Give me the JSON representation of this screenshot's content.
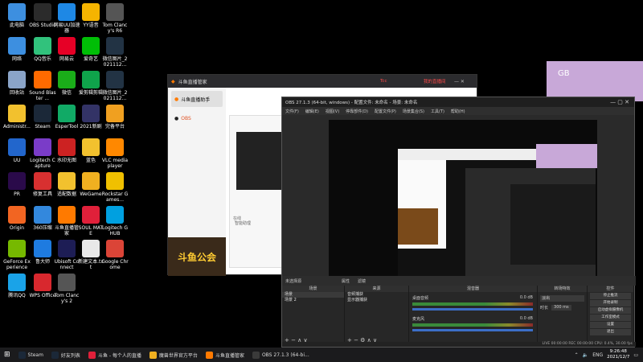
{
  "desktop": {
    "icons": [
      {
        "label": "此电脑",
        "color": "#3d8fe0"
      },
      {
        "label": "OBS Studio",
        "color": "#2b2b2b"
      },
      {
        "label": "网易UU加速器",
        "color": "#1e88e5"
      },
      {
        "label": "YY语音",
        "color": "#f5b400"
      },
      {
        "label": "Tom Clancy's R6",
        "color": "#555555"
      },
      {
        "label": "网络",
        "color": "#3d8fe0"
      },
      {
        "label": "QQ音乐",
        "color": "#31c27c"
      },
      {
        "label": "网易云",
        "color": "#e60026"
      },
      {
        "label": "爱奇艺",
        "color": "#00be06"
      },
      {
        "label": "微信图片_2021112...",
        "color": "#223344"
      },
      {
        "label": "回收站",
        "color": "#8aa4c8"
      },
      {
        "label": "Sound Blaster ...",
        "color": "#ff6a00"
      },
      {
        "label": "微信",
        "color": "#1aad19"
      },
      {
        "label": "爱剪辑剪辑",
        "color": "#0fa34b"
      },
      {
        "label": "微信图片_2021112...",
        "color": "#223344"
      },
      {
        "label": "Administr...",
        "color": "#f2c12e"
      },
      {
        "label": "Steam",
        "color": "#1b2838"
      },
      {
        "label": "EsperTool",
        "color": "#11aa66"
      },
      {
        "label": "2021新剧",
        "color": "#333366"
      },
      {
        "label": "完备平台",
        "color": "#f0a020"
      },
      {
        "label": "UU",
        "color": "#2266cc"
      },
      {
        "label": "Logitech Capture",
        "color": "#7a3cc8"
      },
      {
        "label": "水印无图",
        "color": "#cc2222"
      },
      {
        "label": "蓝色",
        "color": "#f2c12e"
      },
      {
        "label": "VLC media player",
        "color": "#ff8800"
      },
      {
        "label": "PR",
        "color": "#2a0a4a"
      },
      {
        "label": "修复工具",
        "color": "#d83030"
      },
      {
        "label": "适配数据",
        "color": "#f2c12e"
      },
      {
        "label": "WeGame",
        "color": "#f0b020"
      },
      {
        "label": "Rockstar Games...",
        "color": "#f0c000"
      },
      {
        "label": "Origin",
        "color": "#f26522"
      },
      {
        "label": "360压缩",
        "color": "#3388dd"
      },
      {
        "label": "斗鱼直播管家",
        "color": "#ff7a00"
      },
      {
        "label": "SOUL MATE",
        "color": "#e0203a"
      },
      {
        "label": "Logitech G HUB",
        "color": "#00a0e0"
      },
      {
        "label": "GeForce Experience",
        "color": "#76b900"
      },
      {
        "label": "鲁大师",
        "color": "#1e7be0"
      },
      {
        "label": "Ubisoft Connect",
        "color": "#1d1d55"
      },
      {
        "label": "新建文本.txt",
        "color": "#e8e8e8"
      },
      {
        "label": "Google Chrome",
        "color": "#db4437"
      },
      {
        "label": "腾讯QQ",
        "color": "#1aa3e8"
      },
      {
        "label": "WPS Office",
        "color": "#d8282e"
      },
      {
        "label": "Tom Clancy's 2",
        "color": "#555555"
      }
    ]
  },
  "douyu": {
    "title": "斗鱼直播管家",
    "user_label": "Tcc",
    "top_link": "我的直播间",
    "sidebar": [
      "斗鱼直播助手",
      "OBS"
    ],
    "banner": "斗鱼公会",
    "footer_left": "在线",
    "footer_right": "智能助理"
  },
  "obs": {
    "title": "OBS 27.1.3 (64-bit, windows) - 配置文件: 未命名 - 场景: 未命名",
    "menu": [
      "文件(F)",
      "编辑(E)",
      "视图(V)",
      "停靠部件(D)",
      "配置文件(P)",
      "场景集合(S)",
      "工具(T)",
      "帮助(H)"
    ],
    "no_source": "未选择源",
    "props_btn": "属性",
    "filter_btn": "滤镜",
    "docks": {
      "scenes": {
        "title": "场景",
        "items": [
          "场景",
          "场景 2"
        ]
      },
      "sources": {
        "title": "来源",
        "items": [
          "音频捕获",
          "显示器捕获"
        ]
      },
      "mixer": {
        "title": "混音器",
        "tracks": [
          {
            "name": "桌面音频",
            "db": "0.0 dB"
          },
          {
            "name": "麦克风",
            "db": "0.0 dB"
          }
        ]
      },
      "transitions": {
        "title": "转场特效",
        "mode": "淡出",
        "duration_label": "时长",
        "duration": "300 ms"
      },
      "controls": {
        "title": "控件",
        "buttons": [
          "停止推流",
          "开始录制",
          "启动虚拟摄像机",
          "工作室模式",
          "设置",
          "退出"
        ]
      }
    },
    "status": "LIVE 00:00:00  REC 00:00:00  CPU: 0.4%, 30.00 fps"
  },
  "taskbar": {
    "items": [
      {
        "label": "Steam",
        "color": "#1b2838"
      },
      {
        "label": "好友列表",
        "color": "#1b2838"
      },
      {
        "label": "斗鱼 - 每个人的直播",
        "color": "#e0203a"
      },
      {
        "label": "魔兽世界官方平台",
        "color": "#f0b020"
      },
      {
        "label": "斗鱼直播管家",
        "color": "#ff7a00"
      },
      {
        "label": "OBS 27.1.3 (64-bi...",
        "color": "#3a3a3a"
      }
    ],
    "lang": "ENG",
    "time": "9:26:48",
    "date": "2021/12/7"
  },
  "floating": {
    "text": "GB"
  }
}
